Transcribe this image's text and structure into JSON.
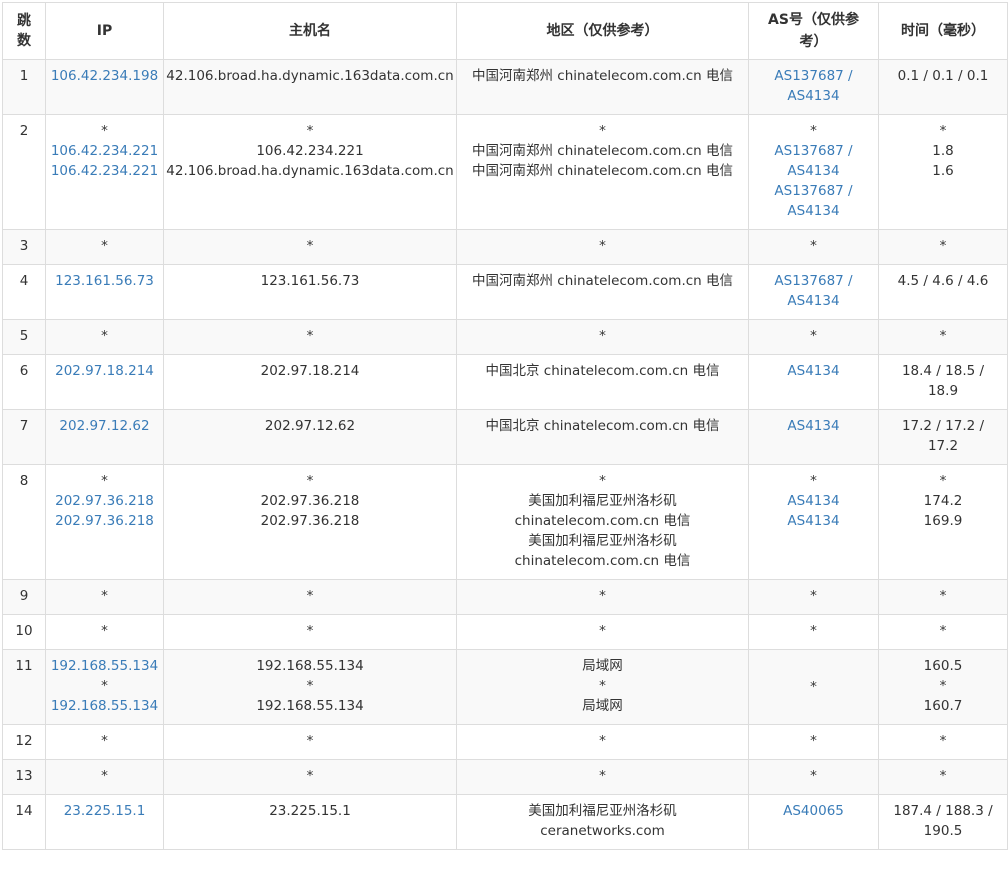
{
  "headers": {
    "hop": "跳数",
    "ip": "IP",
    "host": "主机名",
    "region": "地区（仅供参考）",
    "as": "AS号（仅供参考）",
    "time": "时间（毫秒）"
  },
  "rows": [
    {
      "hop": "1",
      "ip": [
        "106.42.234.198"
      ],
      "host": [
        "42.106.broad.ha.dynamic.163data.com.cn"
      ],
      "region": [
        "中国河南郑州 chinatelecom.com.cn 电信"
      ],
      "as": [
        "AS137687 /",
        "AS4134"
      ],
      "time": [
        "0.1 / 0.1 / 0.1"
      ]
    },
    {
      "hop": "2",
      "ip": [
        "*",
        "106.42.234.221",
        "106.42.234.221"
      ],
      "host": [
        "*",
        "106.42.234.221",
        "42.106.broad.ha.dynamic.163data.com.cn"
      ],
      "region": [
        "*",
        "中国河南郑州 chinatelecom.com.cn 电信",
        "中国河南郑州 chinatelecom.com.cn 电信"
      ],
      "as": [
        "*",
        "AS137687 /",
        "AS4134",
        "AS137687 /",
        "AS4134"
      ],
      "time": [
        "*",
        "1.8",
        "1.6"
      ]
    },
    {
      "hop": "3",
      "ip": [
        "*"
      ],
      "host": [
        "*"
      ],
      "region": [
        "*"
      ],
      "as": [
        "*"
      ],
      "time": [
        "*"
      ]
    },
    {
      "hop": "4",
      "ip": [
        "123.161.56.73"
      ],
      "host": [
        "123.161.56.73"
      ],
      "region": [
        "中国河南郑州 chinatelecom.com.cn 电信"
      ],
      "as": [
        "AS137687 /",
        "AS4134"
      ],
      "time": [
        "4.5 / 4.6 / 4.6"
      ]
    },
    {
      "hop": "5",
      "ip": [
        "*"
      ],
      "host": [
        "*"
      ],
      "region": [
        "*"
      ],
      "as": [
        "*"
      ],
      "time": [
        "*"
      ]
    },
    {
      "hop": "6",
      "ip": [
        "202.97.18.214"
      ],
      "host": [
        "202.97.18.214"
      ],
      "region": [
        "中国北京 chinatelecom.com.cn 电信"
      ],
      "as": [
        "AS4134"
      ],
      "time": [
        "18.4 / 18.5 /",
        "18.9"
      ]
    },
    {
      "hop": "7",
      "ip": [
        "202.97.12.62"
      ],
      "host": [
        "202.97.12.62"
      ],
      "region": [
        "中国北京 chinatelecom.com.cn 电信"
      ],
      "as": [
        "AS4134"
      ],
      "time": [
        "17.2 / 17.2 /",
        "17.2"
      ]
    },
    {
      "hop": "8",
      "ip": [
        "*",
        "202.97.36.218",
        "202.97.36.218"
      ],
      "host": [
        "*",
        "202.97.36.218",
        "202.97.36.218"
      ],
      "region": [
        "*",
        "美国加利福尼亚州洛杉矶",
        "chinatelecom.com.cn 电信",
        "美国加利福尼亚州洛杉矶",
        "chinatelecom.com.cn 电信"
      ],
      "as": [
        "*",
        "AS4134",
        "AS4134"
      ],
      "time": [
        "*",
        "174.2",
        "169.9"
      ]
    },
    {
      "hop": "9",
      "ip": [
        "*"
      ],
      "host": [
        "*"
      ],
      "region": [
        "*"
      ],
      "as": [
        "*"
      ],
      "time": [
        "*"
      ]
    },
    {
      "hop": "10",
      "ip": [
        "*"
      ],
      "host": [
        "*"
      ],
      "region": [
        "*"
      ],
      "as": [
        "*"
      ],
      "time": [
        "*"
      ]
    },
    {
      "hop": "11",
      "ip": [
        "192.168.55.134",
        "*",
        "192.168.55.134"
      ],
      "host": [
        "192.168.55.134",
        "*",
        "192.168.55.134"
      ],
      "region": [
        "局域网",
        "*",
        "局域网"
      ],
      "as": [
        "*"
      ],
      "as_middle": true,
      "time": [
        "160.5",
        "*",
        "160.7"
      ]
    },
    {
      "hop": "12",
      "ip": [
        "*"
      ],
      "host": [
        "*"
      ],
      "region": [
        "*"
      ],
      "as": [
        "*"
      ],
      "time": [
        "*"
      ]
    },
    {
      "hop": "13",
      "ip": [
        "*"
      ],
      "host": [
        "*"
      ],
      "region": [
        "*"
      ],
      "as": [
        "*"
      ],
      "time": [
        "*"
      ]
    },
    {
      "hop": "14",
      "ip": [
        "23.225.15.1"
      ],
      "host": [
        "23.225.15.1"
      ],
      "region": [
        "美国加利福尼亚州洛杉矶",
        "ceranetworks.com"
      ],
      "as": [
        "AS40065"
      ],
      "time": [
        "187.4 / 188.3 /",
        "190.5"
      ]
    }
  ]
}
